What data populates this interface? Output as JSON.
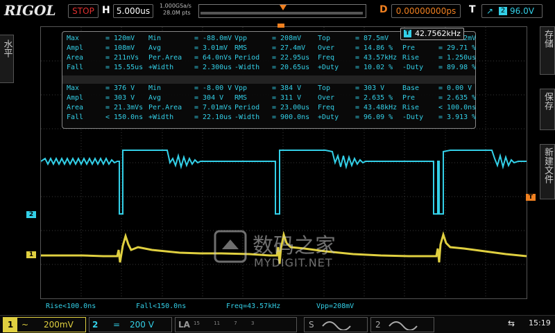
{
  "header": {
    "brand": "RIGOL",
    "run_state": "STOP",
    "horizontal_label": "H",
    "timebase": "5.000us",
    "sample_rate": "1.000GSa/s",
    "memory_depth": "28.0M pts",
    "delay_label": "D",
    "delay": "0.00000000ps",
    "trigger_label": "T",
    "trigger_source": "2",
    "trigger_level": "96.0V",
    "trigger_edge": "rising-edge-icon"
  },
  "side_left": {
    "label": "水平"
  },
  "side_right": {
    "items": [
      "存储",
      "保存",
      "新建文件"
    ]
  },
  "freq_badge": {
    "label": "T",
    "value": "42.7562kHz"
  },
  "measurements": {
    "rows": [
      [
        "Max",
        "= 120mV",
        "Min",
        "= -88.0mV",
        "Vpp",
        "= 208mV",
        "Top",
        "= 87.5mV",
        "Base",
        "= -20.2mV"
      ],
      [
        "Ampl",
        "= 108mV",
        "Avg",
        "= 3.01mV",
        "RMS",
        "= 27.4mV",
        "Over",
        "= 14.86 %",
        "Pre",
        "= 29.71 %"
      ],
      [
        "Area",
        "= 211nVs",
        "Per.Area",
        "= 64.0nVs",
        "Period",
        "= 22.95us",
        "Freq",
        "= 43.57kHz",
        "Rise",
        "= 1.250us"
      ],
      [
        "Fall",
        "= 15.55us",
        "+Width",
        "= 2.300us",
        "-Width",
        "= 20.65us",
        "+Duty",
        "= 10.02 %",
        "-Duty",
        "= 89.98 %"
      ],
      [
        "Max",
        "= 376 V",
        "Min",
        "= -8.00 V",
        "Vpp",
        "= 384 V",
        "Top",
        "= 303 V",
        "Base",
        "= 0.00 V"
      ],
      [
        "Ampl",
        "= 303 V",
        "Avg",
        "= 304 V",
        "RMS",
        "= 311 V",
        "Over",
        "= 2.635 %",
        "Pre",
        "= 2.635 %"
      ],
      [
        "Area",
        "= 21.3mVs",
        "Per.Area",
        "= 7.01mVs",
        "Period",
        "= 23.00us",
        "Freq",
        "= 43.48kHz",
        "Rise",
        "< 100.0ns"
      ],
      [
        "Fall",
        "< 150.0ns",
        "+Width",
        "= 22.10us",
        "-Width",
        "= 900.0ns",
        "+Duty",
        "= 96.09 %",
        "-Duty",
        "= 3.913 %"
      ]
    ]
  },
  "markers": {
    "ch2": "2",
    "ch1": "1",
    "trigger": "T"
  },
  "status_line": {
    "rise": "Rise<100.0ns",
    "fall": "Fall<150.0ns",
    "freq": "Freq=43.57kHz",
    "vpp": "Vpp=208mV"
  },
  "channels": {
    "ch1": {
      "number": "1",
      "coupling": "~",
      "scale": "200mV"
    },
    "ch2": {
      "number": "2",
      "coupling": "=",
      "scale": "200 V"
    },
    "la": {
      "label": "LA",
      "digits": "15 11 7 3"
    },
    "s1": {
      "label": "S"
    },
    "s2": {
      "label": "2"
    }
  },
  "system": {
    "time": "15:19"
  },
  "watermark": {
    "cn": "数码之家",
    "en": "MYDIGIT.NET"
  },
  "colors": {
    "ch1": "#e0d040",
    "ch2": "#33d0e8",
    "accent": "#f08020",
    "stop": "#e03030"
  }
}
